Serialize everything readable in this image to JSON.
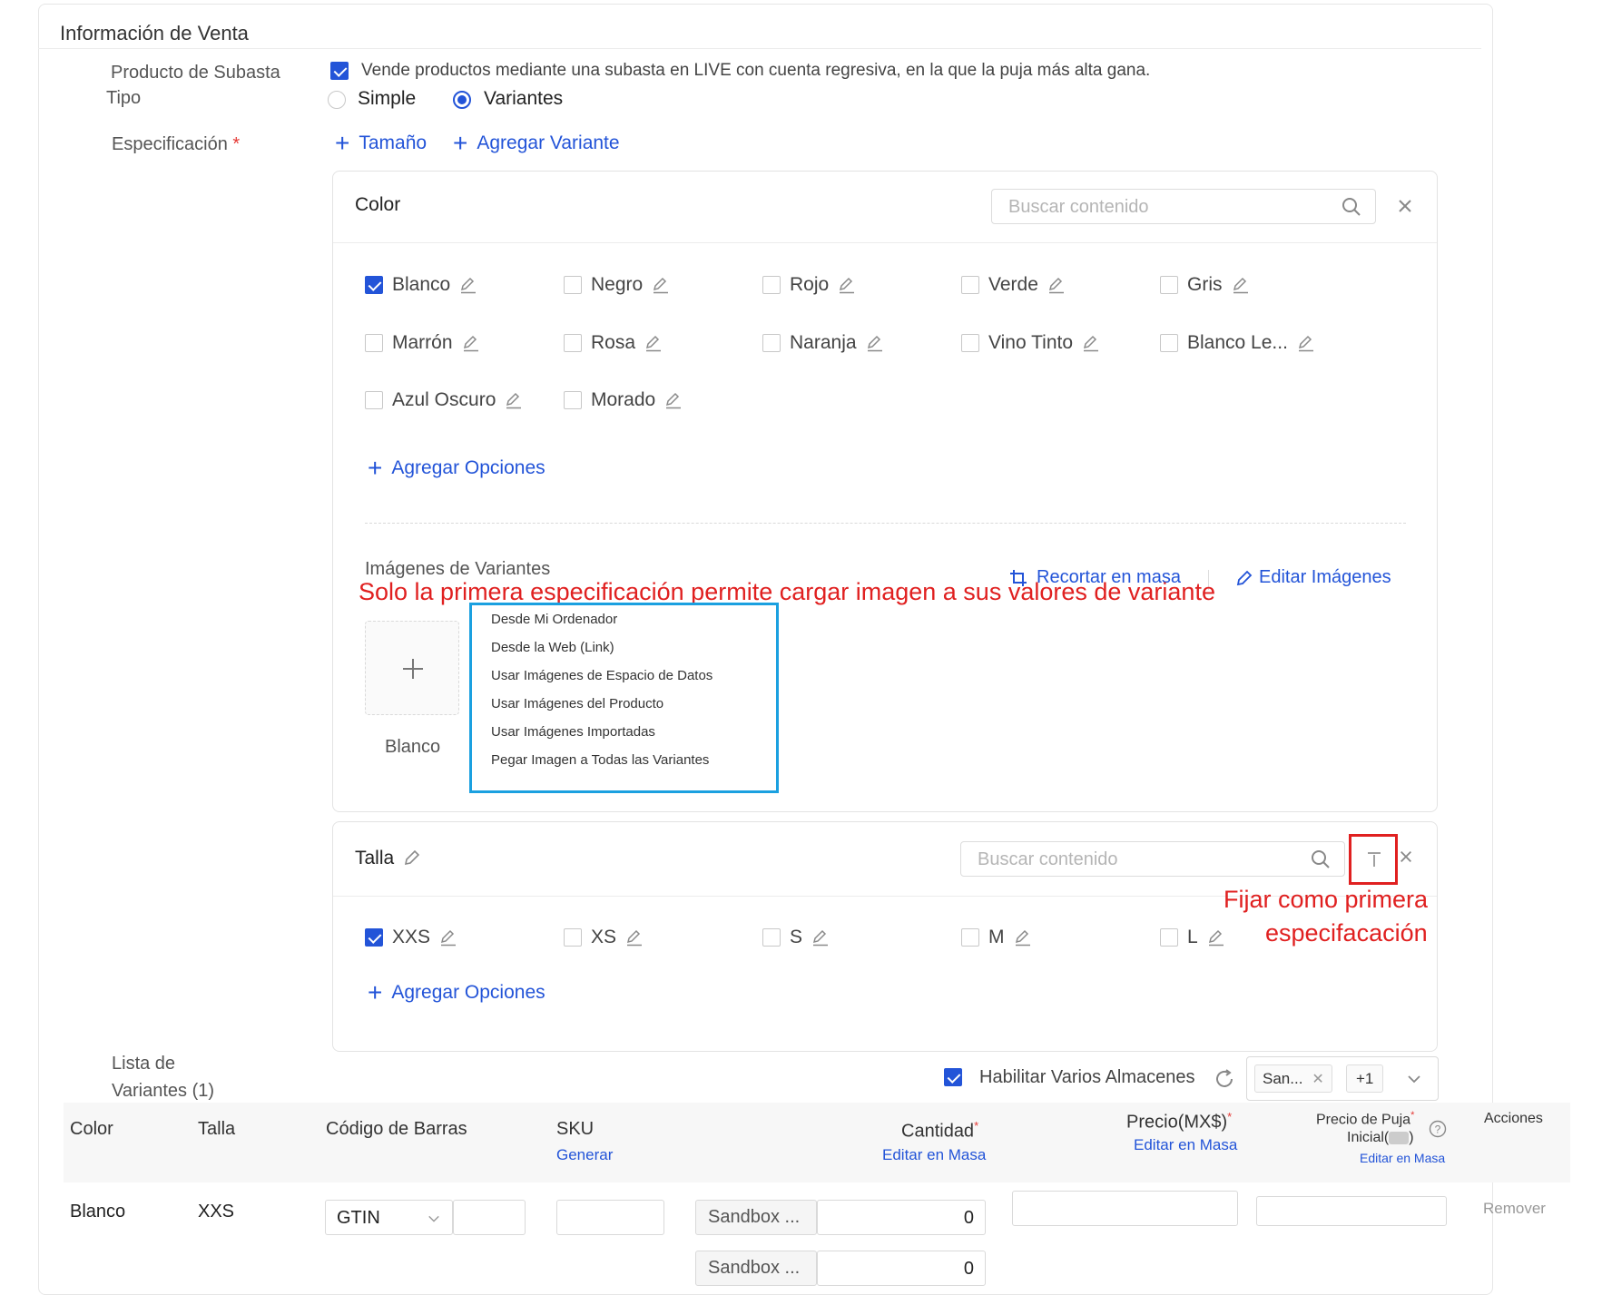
{
  "section": {
    "title": "Información de Venta"
  },
  "auction": {
    "label": "Producto de Subasta",
    "checked": true,
    "text": "Vende productos mediante una subasta en LIVE con cuenta regresiva, en la que la puja más alta  gana."
  },
  "tipo": {
    "label": "Tipo",
    "options": [
      "Simple",
      "Variantes"
    ],
    "selected": "Variantes"
  },
  "especificacion": {
    "label": "Especificación",
    "required_mark": "*",
    "add_size": "Tamaño",
    "add_variant": "Agregar Variante"
  },
  "color_panel": {
    "title": "Color",
    "search_placeholder": "Buscar contenido",
    "options": [
      {
        "label": "Blanco",
        "checked": true
      },
      {
        "label": "Negro",
        "checked": false
      },
      {
        "label": "Rojo",
        "checked": false
      },
      {
        "label": "Verde",
        "checked": false
      },
      {
        "label": "Gris",
        "checked": false
      },
      {
        "label": "Marrón",
        "checked": false
      },
      {
        "label": "Rosa",
        "checked": false
      },
      {
        "label": "Naranja",
        "checked": false
      },
      {
        "label": "Vino Tinto",
        "checked": false
      },
      {
        "label": "Blanco Le...",
        "checked": false
      },
      {
        "label": "Azul Oscuro",
        "checked": false
      },
      {
        "label": "Morado",
        "checked": false
      }
    ],
    "add_options": "Agregar Opciones",
    "images_label": "Imágenes de Variantes",
    "crop_bulk": "Recortar en masa",
    "edit_images": "Editar Imágenes",
    "upload_caption": "Blanco"
  },
  "annotation_first_spec": "Solo la primera especificación permite cargar imagen a sus valores de variante",
  "upload_menu": [
    "Desde Mi Ordenador",
    "Desde la Web (Link)",
    "Usar Imágenes de Espacio de Datos",
    "Usar Imágenes del Producto",
    "Usar Imágenes Importadas",
    "Pegar Imagen a Todas las Variantes"
  ],
  "talla_panel": {
    "title": "Talla",
    "search_placeholder": "Buscar contenido",
    "options": [
      {
        "label": "XXS",
        "checked": true
      },
      {
        "label": "XS",
        "checked": false
      },
      {
        "label": "S",
        "checked": false
      },
      {
        "label": "M",
        "checked": false
      },
      {
        "label": "L",
        "checked": false
      }
    ],
    "add_options": "Agregar Opciones"
  },
  "annotation_pin": {
    "line1": "Fijar como primera",
    "line2": "especifacación"
  },
  "variant_list": {
    "label_line1": "Lista de",
    "label_line2": "Variantes (1)",
    "multi_warehouse_label": "Habilitar Varios Almacenes",
    "multi_warehouse_checked": true,
    "warehouse_tag": "San...",
    "warehouse_more": "+1"
  },
  "table": {
    "headers": {
      "color": "Color",
      "talla": "Talla",
      "barcode": "Código de Barras",
      "sku": "SKU",
      "sku_action": "Generar",
      "qty": "Cantidad",
      "qty_action": "Editar en Masa",
      "price": "Precio(MX$)",
      "price_action": "Editar en Masa",
      "bid_line1": "Precio de Puja",
      "bid_line2": "Inicial(",
      "bid_line2_end": ")",
      "bid_action": "Editar en Masa",
      "actions": "Acciones"
    },
    "row": {
      "color": "Blanco",
      "talla": "XXS",
      "barcode_type": "GTIN",
      "warehouses": [
        {
          "name": "Sandbox ...",
          "qty": "0"
        },
        {
          "name": "Sandbox ...",
          "qty": "0"
        }
      ],
      "remove": "Remover"
    }
  }
}
